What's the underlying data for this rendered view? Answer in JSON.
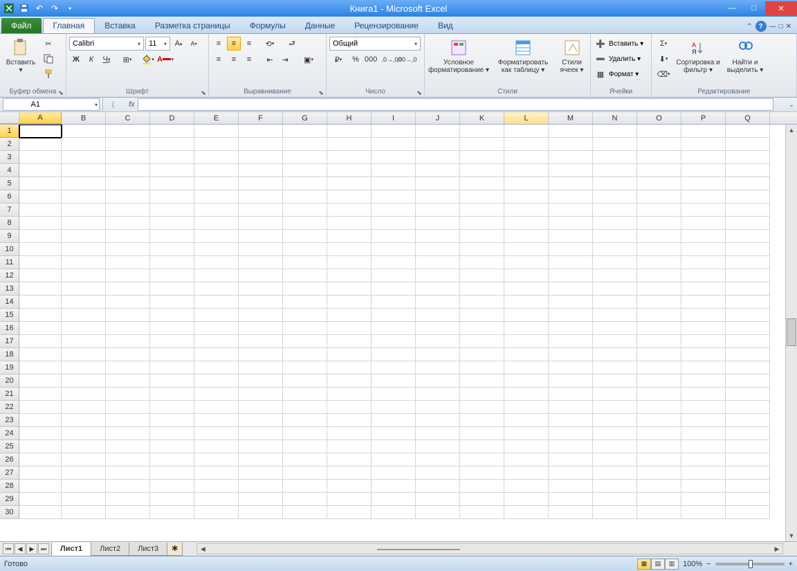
{
  "title": "Книга1 - Microsoft Excel",
  "tabs": {
    "file": "Файл",
    "items": [
      "Главная",
      "Вставка",
      "Разметка страницы",
      "Формулы",
      "Данные",
      "Рецензирование",
      "Вид"
    ],
    "active": "Главная"
  },
  "ribbon": {
    "clipboard": {
      "paste": "Вставить",
      "label": "Буфер обмена"
    },
    "font": {
      "name": "Calibri",
      "size": "11",
      "label": "Шрифт",
      "bold": "Ж",
      "italic": "К",
      "underline": "Ч"
    },
    "alignment": {
      "label": "Выравнивание"
    },
    "number": {
      "format": "Общий",
      "label": "Число"
    },
    "styles": {
      "conditional": "Условное форматирование",
      "table": "Форматировать как таблицу",
      "cell": "Стили ячеек",
      "label": "Стили"
    },
    "cells": {
      "insert": "Вставить",
      "delete": "Удалить",
      "format": "Формат",
      "label": "Ячейки"
    },
    "editing": {
      "sort": "Сортировка и фильтр",
      "find": "Найти и выделить",
      "label": "Редактирование"
    }
  },
  "namebox": "A1",
  "columns": [
    "A",
    "B",
    "C",
    "D",
    "E",
    "F",
    "G",
    "H",
    "I",
    "J",
    "K",
    "L",
    "M",
    "N",
    "O",
    "P",
    "Q"
  ],
  "hovered_col": "L",
  "rows_count": 30,
  "selected_cell": "A1",
  "sheets": {
    "items": [
      "Лист1",
      "Лист2",
      "Лист3"
    ],
    "active": "Лист1"
  },
  "status": {
    "ready": "Готово",
    "zoom": "100%"
  }
}
